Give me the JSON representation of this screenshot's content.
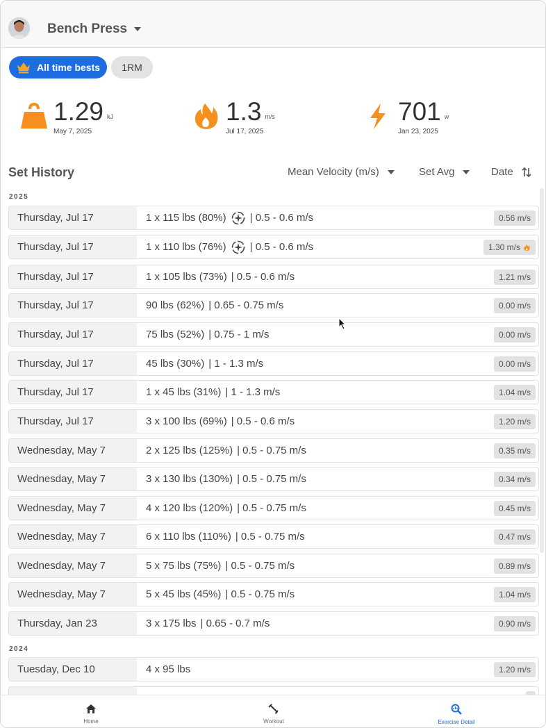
{
  "header": {
    "title": "Bench Press"
  },
  "chips": {
    "active": "All time bests",
    "inactive": "1RM"
  },
  "stats": [
    {
      "value": "1.29",
      "unit": "kJ",
      "date": "May 7, 2025",
      "icon": "kettlebell-icon"
    },
    {
      "value": "1.3",
      "unit": "m/s",
      "date": "Jul 17, 2025",
      "icon": "flame-icon"
    },
    {
      "value": "701",
      "unit": "w",
      "date": "Jan 23, 2025",
      "icon": "lightning-icon"
    }
  ],
  "set_history": {
    "title": "Set History",
    "metric": "Mean Velocity (m/s)",
    "aggregate": "Set Avg",
    "sort": "Date"
  },
  "years": [
    "2025",
    "2024"
  ],
  "rows": [
    {
      "date": "Thursday, Jul 17",
      "detail": "1 x 115 lbs (80%)",
      "target": "| 0.5 - 0.6 m/s",
      "velocity": "0.56 m/s",
      "hasAuto": true,
      "best": false
    },
    {
      "date": "Thursday, Jul 17",
      "detail": "1 x 110 lbs (76%)",
      "target": "| 0.5 - 0.6 m/s",
      "velocity": "1.30 m/s",
      "hasAuto": true,
      "best": true
    },
    {
      "date": "Thursday, Jul 17",
      "detail": "1 x 105 lbs (73%)",
      "target": "| 0.5 - 0.6 m/s",
      "velocity": "1.21 m/s",
      "hasAuto": false,
      "best": false
    },
    {
      "date": "Thursday, Jul 17",
      "detail": "90 lbs (62%)",
      "target": "| 0.65 - 0.75 m/s",
      "velocity": "0.00 m/s",
      "hasAuto": false,
      "best": false
    },
    {
      "date": "Thursday, Jul 17",
      "detail": "75 lbs (52%)",
      "target": "| 0.75 - 1 m/s",
      "velocity": "0.00 m/s",
      "hasAuto": false,
      "best": false
    },
    {
      "date": "Thursday, Jul 17",
      "detail": "45 lbs (30%)",
      "target": "| 1 - 1.3 m/s",
      "velocity": "0.00 m/s",
      "hasAuto": false,
      "best": false
    },
    {
      "date": "Thursday, Jul 17",
      "detail": "1 x 45 lbs (31%)",
      "target": "| 1 - 1.3 m/s",
      "velocity": "1.04 m/s",
      "hasAuto": false,
      "best": false
    },
    {
      "date": "Thursday, Jul 17",
      "detail": "3 x 100 lbs (69%)",
      "target": "| 0.5 - 0.6 m/s",
      "velocity": "1.20 m/s",
      "hasAuto": false,
      "best": false
    },
    {
      "date": "Wednesday, May 7",
      "detail": "2 x 125 lbs (125%)",
      "target": "| 0.5 - 0.75 m/s",
      "velocity": "0.35 m/s",
      "hasAuto": false,
      "best": false
    },
    {
      "date": "Wednesday, May 7",
      "detail": "3 x 130 lbs (130%)",
      "target": "| 0.5 - 0.75 m/s",
      "velocity": "0.34 m/s",
      "hasAuto": false,
      "best": false
    },
    {
      "date": "Wednesday, May 7",
      "detail": "4 x 120 lbs (120%)",
      "target": "| 0.5 - 0.75 m/s",
      "velocity": "0.45 m/s",
      "hasAuto": false,
      "best": false
    },
    {
      "date": "Wednesday, May 7",
      "detail": "6 x 110 lbs (110%)",
      "target": "| 0.5 - 0.75 m/s",
      "velocity": "0.47 m/s",
      "hasAuto": false,
      "best": false
    },
    {
      "date": "Wednesday, May 7",
      "detail": "5 x 75 lbs (75%)",
      "target": "| 0.5 - 0.75 m/s",
      "velocity": "0.89 m/s",
      "hasAuto": false,
      "best": false
    },
    {
      "date": "Wednesday, May 7",
      "detail": "5 x 45 lbs (45%)",
      "target": "| 0.5 - 0.75 m/s",
      "velocity": "1.04 m/s",
      "hasAuto": false,
      "best": false
    },
    {
      "date": "Thursday, Jan 23",
      "detail": "3 x 175 lbs",
      "target": "| 0.65 - 0.7 m/s",
      "velocity": "0.90 m/s",
      "hasAuto": false,
      "best": false
    },
    {
      "date": "Tuesday, Dec 10",
      "detail": "4 x 95 lbs",
      "target": "",
      "velocity": "1.20 m/s",
      "hasAuto": false,
      "best": false
    }
  ],
  "nav": [
    {
      "label": "Home",
      "icon": "home-icon"
    },
    {
      "label": "Workout",
      "icon": "dumbbell-icon"
    },
    {
      "label": "Exercise Detail",
      "icon": "search-chart-icon"
    }
  ],
  "colors": {
    "accent": "#1d6de0",
    "orange": "#f5901e"
  }
}
